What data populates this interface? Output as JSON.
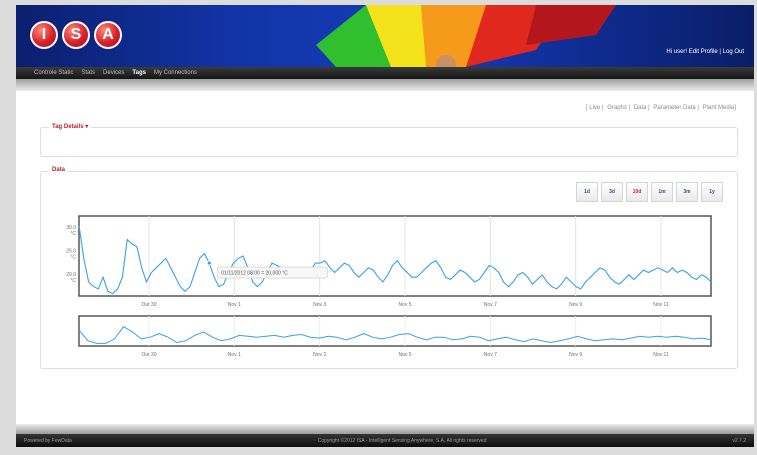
{
  "header": {
    "logo_letters": [
      "I",
      "S",
      "A"
    ],
    "right_text": "Hi user! Edit Profile | Log Out"
  },
  "nav": {
    "items": [
      "Controle Static",
      "Stats",
      "Devices",
      "Tags",
      "My Connections"
    ],
    "active_index": 3
  },
  "top_links": [
    "Live",
    "Graphs",
    "Data",
    "Parameter Data",
    "Plant Media"
  ],
  "tag_details": {
    "title": "Tag Details"
  },
  "data_panel": {
    "title": "Data"
  },
  "range_buttons": [
    "1d",
    "3d",
    "10d",
    "1m",
    "3m",
    "1y"
  ],
  "range_active": "10d",
  "tooltip": "01/11/2012 08:00 = 20,000 °C",
  "footer": {
    "left": "Powered by FewData",
    "center": "Copyright ©2012 ISA - Intelligent Sensing Anywhere, S.A. All rights reserved",
    "right": "v2.7.2"
  },
  "chart_data": {
    "type": "line",
    "title": "",
    "xlabel": "",
    "ylabel": "",
    "x_ticks": [
      "Out 30",
      "Nov 1",
      "Nov 3",
      "Nov 5",
      "Nov 7",
      "Nov 9",
      "Nov 11"
    ],
    "y_ticks": [
      "30.0 °C",
      "25.0 °C",
      "20.0 °C"
    ],
    "ylim": [
      16,
      33
    ],
    "series": [
      {
        "values": [
          31,
          24,
          19,
          18,
          17.5,
          20,
          17,
          16.5,
          17.5,
          20,
          28,
          27,
          26.5,
          22,
          19,
          21,
          22,
          23,
          24,
          22,
          20,
          18,
          17,
          18,
          21,
          24,
          25,
          23,
          20,
          18,
          18.5,
          21,
          23,
          24,
          24.5,
          22,
          19,
          18,
          19,
          21,
          23,
          22.5,
          22,
          21,
          21.5,
          22,
          21,
          20.5,
          21.5,
          23,
          23,
          23.5,
          22,
          21,
          22,
          23,
          22.5,
          21,
          20,
          21,
          22,
          21.5,
          20,
          19,
          20.5,
          22.5,
          23.5,
          22,
          21,
          20,
          20,
          21,
          22,
          23,
          23.5,
          22,
          20,
          19.5,
          20.5,
          21.5,
          21,
          20,
          19,
          19.5,
          21,
          22.5,
          22,
          21,
          19,
          18,
          19,
          20.5,
          21,
          20,
          18.5,
          19.5,
          20.5,
          19,
          18,
          17.5,
          18.5,
          20,
          19,
          18,
          17.5,
          19,
          20,
          21,
          22,
          21.5,
          20,
          19,
          18.5,
          19.5,
          20.5,
          19.5,
          20.5,
          21.5,
          21,
          21.5,
          22,
          21.5,
          21,
          22,
          21,
          21.5,
          21,
          20,
          19.5,
          20.5,
          20,
          19
        ]
      }
    ],
    "navigator_values": [
      25,
      19,
      17.5,
      17.5,
      20,
      27,
      24,
      20,
      21,
      23,
      21,
      18,
      19,
      22,
      24,
      21,
      19,
      20,
      22,
      21.5,
      21,
      21.5,
      22,
      21,
      22,
      22.5,
      21,
      20.5,
      21.5,
      21,
      19.5,
      21,
      23,
      21,
      20,
      21,
      22.5,
      23,
      21,
      19.5,
      21,
      21,
      19.5,
      20,
      21.5,
      21,
      19,
      20,
      21,
      19.5,
      18.5,
      20,
      19,
      18,
      19,
      20,
      21.5,
      20,
      19,
      19.5,
      20,
      19.5,
      20.5,
      21.5,
      21,
      21.5,
      21,
      21.5,
      21,
      20,
      20.5,
      19.5
    ]
  }
}
